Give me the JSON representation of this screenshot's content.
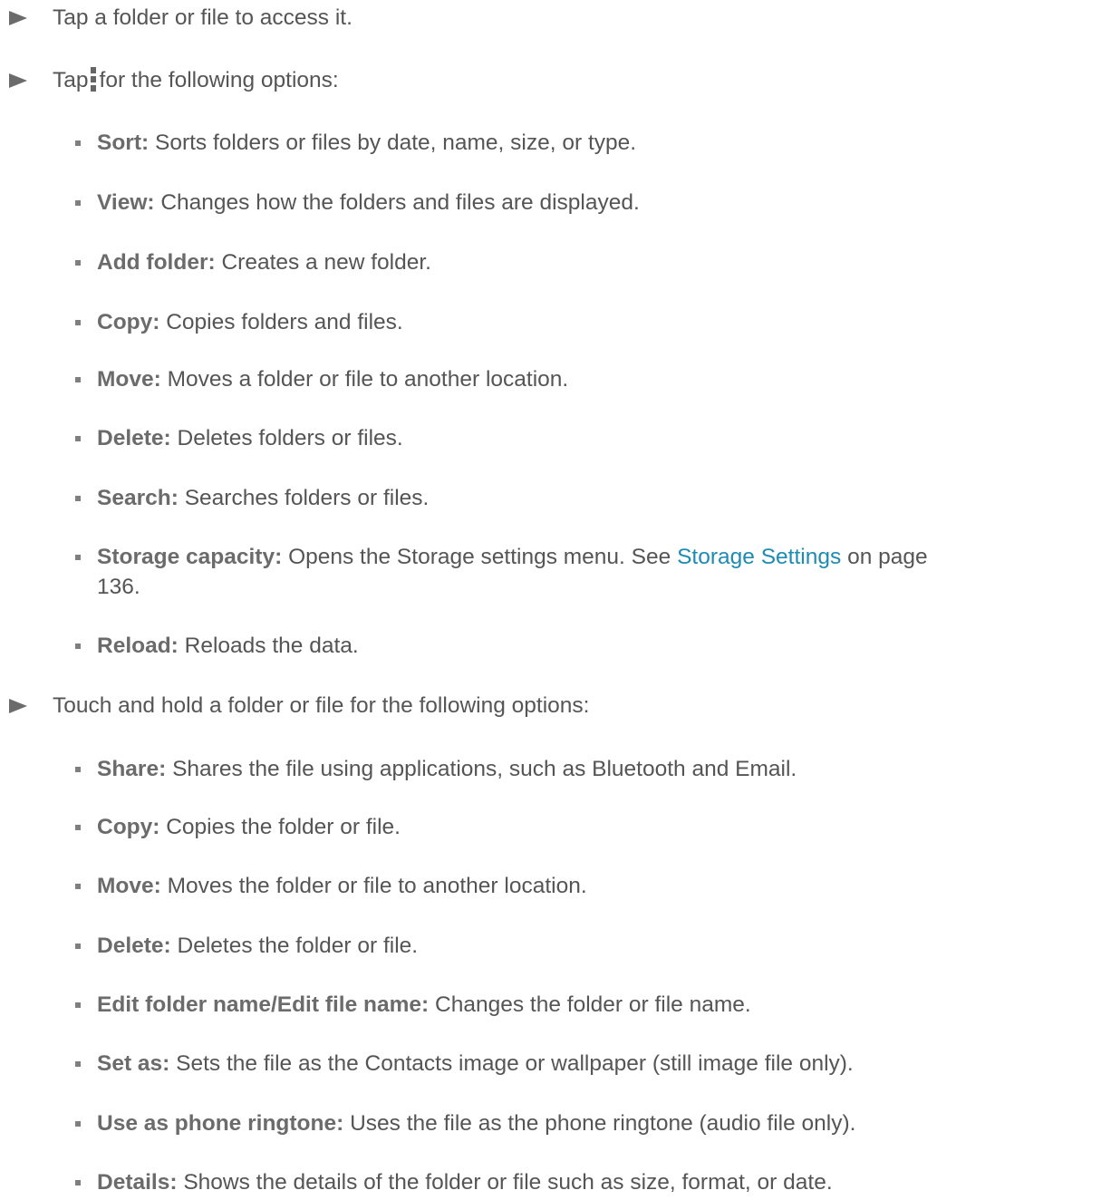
{
  "instructions": [
    {
      "text": "Tap a folder or file to access it."
    },
    {
      "text_before": "Tap",
      "icon": "menu-dots-icon",
      "text_after": "for the following options:",
      "options": [
        {
          "term": "Sort:",
          "desc": "Sorts folders or files by date, name, size, or type."
        },
        {
          "term": "View:",
          "desc": "Changes how the folders and files are displayed."
        },
        {
          "term": "Add folder:",
          "desc": "Creates a new folder."
        },
        {
          "term": "Copy:",
          "desc": "Copies folders and files."
        },
        {
          "term": "Move:",
          "desc": "Moves a folder or file to another location."
        },
        {
          "term": "Delete:",
          "desc": "Deletes folders or files."
        },
        {
          "term": "Search:",
          "desc": "Searches folders or files."
        },
        {
          "term": "Storage capacity:",
          "desc": "Opens the Storage settings menu. See",
          "link": "Storage Settings",
          "desc_after": "on page",
          "desc_line2": "136."
        },
        {
          "term": "Reload:",
          "desc": "Reloads the data."
        }
      ]
    },
    {
      "text": "Touch and hold a folder or file for the following options:",
      "options": [
        {
          "term": "Share:",
          "desc": "Shares the file using applications, such as Bluetooth and Email."
        },
        {
          "term": "Copy:",
          "desc": "Copies the folder or file."
        },
        {
          "term": "Move:",
          "desc": "Moves the folder or file to another location."
        },
        {
          "term": "Delete:",
          "desc": "Deletes the folder or file."
        },
        {
          "term": "Edit folder name/Edit file name:",
          "desc": "Changes the folder or file name."
        },
        {
          "term": "Set as:",
          "desc": "Sets the file as the Contacts image or wallpaper (still image file only)."
        },
        {
          "term": "Use as phone ringtone:",
          "desc": "Uses the file as the phone ringtone (audio file only)."
        },
        {
          "term": "Details:",
          "desc": "Shows the details of the folder or file such as size, format, or date."
        }
      ]
    }
  ]
}
